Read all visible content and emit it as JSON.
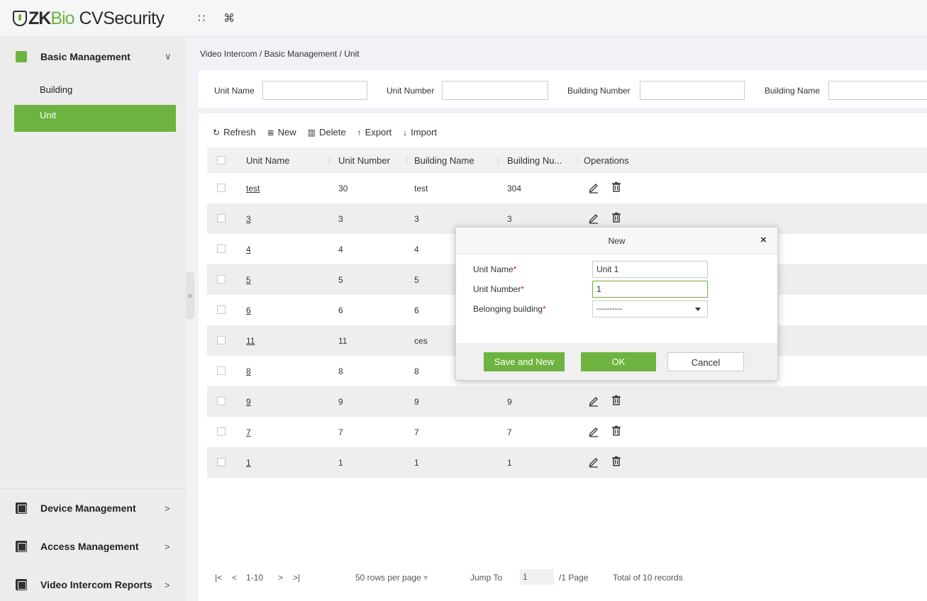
{
  "header": {
    "logo_zk": "ZK",
    "logo_bio": "Bio",
    "logo_cv": "CVSecurity",
    "apps_icon": "grid-icon",
    "shortcut_icon": "command-icon",
    "apps_glyph": "∷",
    "shortcut_glyph": "⌘"
  },
  "sidebar": {
    "menus": [
      {
        "label": "Basic Management",
        "chevron": "∨",
        "icon": "building-user-icon"
      },
      {
        "label": "Device Management",
        "chevron": ">",
        "icon": "device-icon"
      },
      {
        "label": "Access Management",
        "chevron": ">",
        "icon": "access-icon"
      },
      {
        "label": "Video Intercom Reports",
        "chevron": ">",
        "icon": "report-chart-icon"
      }
    ],
    "sub_items": [
      {
        "label": "Building",
        "active": false
      },
      {
        "label": "Unit",
        "active": true
      }
    ],
    "collapse_glyph": "«"
  },
  "breadcrumb": "Video Intercom / Basic Management / Unit",
  "filters": {
    "unit_name": "Unit Name",
    "unit_number": "Unit Number",
    "building_number": "Building Number",
    "building_name": "Building Name"
  },
  "toolbar": {
    "refresh": "Refresh",
    "new": "New",
    "delete": "Delete",
    "export": "Export",
    "import": "Import",
    "refresh_glyph": "↻",
    "new_glyph": "≣",
    "delete_glyph": "▥",
    "export_glyph": "↑",
    "import_glyph": "↓"
  },
  "table": {
    "columns": [
      "Unit Name",
      "Unit Number",
      "Building Name",
      "Building Nu...",
      "Operations"
    ],
    "rows": [
      {
        "unit_name": "test",
        "unit_number": "30",
        "building_name": "test",
        "building_number": "304"
      },
      {
        "unit_name": "3",
        "unit_number": "3",
        "building_name": "3",
        "building_number": "3"
      },
      {
        "unit_name": "4",
        "unit_number": "4",
        "building_name": "4",
        "building_number": ""
      },
      {
        "unit_name": "5",
        "unit_number": "5",
        "building_name": "5",
        "building_number": ""
      },
      {
        "unit_name": "6",
        "unit_number": "6",
        "building_name": "6",
        "building_number": ""
      },
      {
        "unit_name": "11",
        "unit_number": "11",
        "building_name": "ces",
        "building_number": ""
      },
      {
        "unit_name": "8",
        "unit_number": "8",
        "building_name": "8",
        "building_number": ""
      },
      {
        "unit_name": "9",
        "unit_number": "9",
        "building_name": "9",
        "building_number": "9"
      },
      {
        "unit_name": "7",
        "unit_number": "7",
        "building_name": "7",
        "building_number": "7"
      },
      {
        "unit_name": "1",
        "unit_number": "1",
        "building_name": "1",
        "building_number": "1"
      }
    ]
  },
  "pagination": {
    "first": "|<",
    "prev": "<",
    "range": "1-10",
    "next": ">",
    "last": ">|",
    "rows_per_page": "50 rows per page",
    "jump_to": "Jump To",
    "jump_value": "1",
    "page_info": "/1 Page",
    "total": "Total of 10 records"
  },
  "modal": {
    "title": "New",
    "close": "×",
    "fields": {
      "unit_name_label": "Unit Name",
      "unit_name_value": "Unit 1",
      "unit_number_label": "Unit Number",
      "unit_number_value": "1",
      "building_label": "Belonging building",
      "building_value": "----------"
    },
    "required_mark": "*",
    "buttons": {
      "save_and_new": "Save and New",
      "ok": "OK",
      "cancel": "Cancel"
    }
  },
  "colors": {
    "accent": "#6db33f"
  }
}
